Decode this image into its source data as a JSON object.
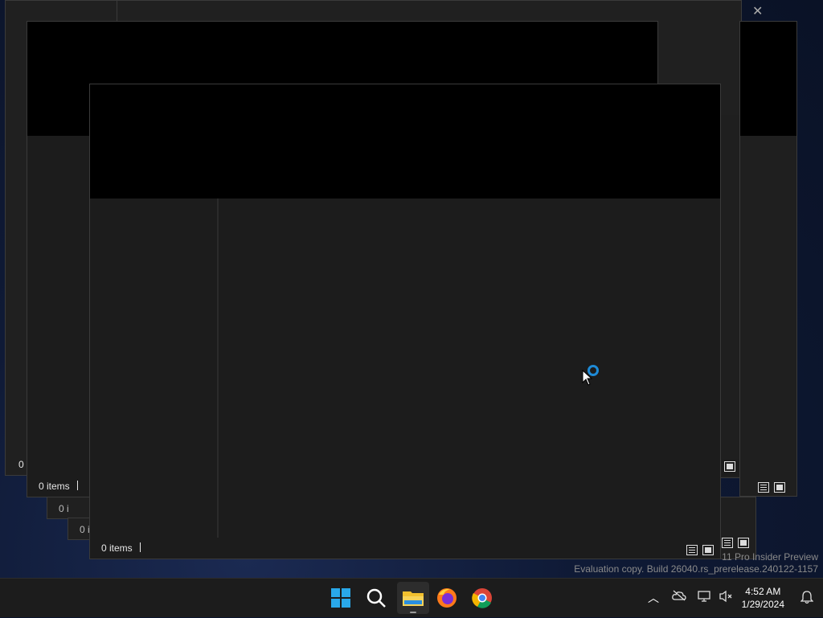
{
  "windows": {
    "back": {
      "status_count": "0 i"
    },
    "back2": {
      "status_count": "0 i"
    },
    "middle": {
      "status_count": "0 items"
    },
    "front": {
      "status_count": "0 items"
    }
  },
  "watermark": {
    "line1": "11 Pro Insider Preview",
    "line2": "Evaluation copy. Build 26040.rs_prerelease.240122-1157"
  },
  "taskbar": {
    "icons": [
      "start-icon",
      "search-icon",
      "file-explorer-icon",
      "firefox-icon",
      "chrome-icon"
    ],
    "tray": {
      "time": "4:52 AM",
      "date": "1/29/2024"
    }
  },
  "colors": {
    "accent": "#1e8ad6",
    "window_bg": "#1c1c1c",
    "titlebar": "#000000"
  }
}
